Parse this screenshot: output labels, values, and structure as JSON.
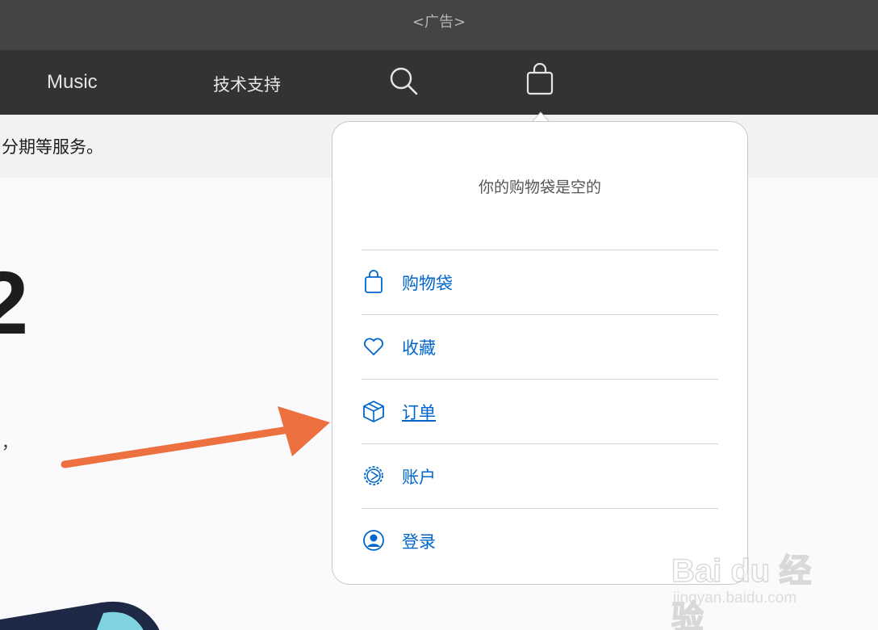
{
  "ad": {
    "label": "<广告>"
  },
  "nav": {
    "music": "Music",
    "support": "技术支持",
    "search_icon": "search-icon",
    "bag_icon": "shopping-bag-icon"
  },
  "promo": {
    "text": "分期等服务。"
  },
  "main": {
    "big_number_fragment": "2",
    "comma_fragment": "，"
  },
  "popover": {
    "empty_message": "你的购物袋是空的",
    "items": [
      {
        "label": "购物袋",
        "icon": "bag-icon"
      },
      {
        "label": "收藏",
        "icon": "heart-icon"
      },
      {
        "label": "订单",
        "icon": "box-icon"
      },
      {
        "label": "账户",
        "icon": "gear-icon"
      },
      {
        "label": "登录",
        "icon": "user-circle-icon"
      }
    ]
  },
  "watermark": {
    "logo": "Bai du 经验",
    "url": "jingyan.baidu.com"
  },
  "colors": {
    "ad_bar": "#444444",
    "nav_bar": "#333333",
    "link_blue": "#0066cc",
    "arrow_orange": "#ec7040"
  }
}
